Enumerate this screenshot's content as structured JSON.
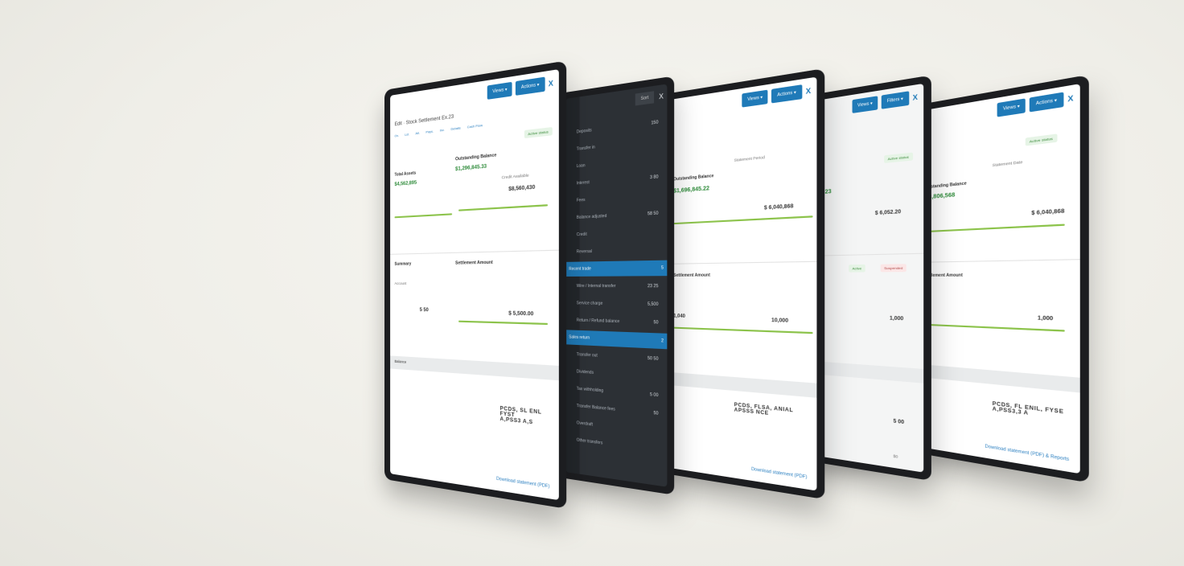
{
  "panels": {
    "p1": {
      "btn1": "Views ▾",
      "btn2": "Actions ▾",
      "close": "X",
      "header": "Edit · Stock Settlement Ex.23",
      "tabs": [
        "Ov.",
        "Lst.",
        "Alt.",
        "Pays.",
        "Inv.",
        "Details",
        "Cash Flow"
      ],
      "badge": "Active status",
      "outstanding_label": "Outstanding Balance",
      "outstanding_value": "$1,296,845.33",
      "left_label": "Total Assets",
      "left_value": "$4,562,895",
      "right_label": "Credit Available",
      "right_value": "$8,560,430",
      "section": "Summary",
      "settlement": "Settlement Amount",
      "account_name": "Account",
      "values_mid": [
        "5 50",
        "$ 5,500.00"
      ],
      "row_label": "Balance",
      "big_value": "PCDS, SL ENL FYST\nA,PSS3 A,S",
      "footer": "Download statement (PDF)"
    },
    "p2": {
      "top_box": "Sort",
      "close": "X",
      "rows": [
        {
          "label": "Deposits",
          "n": "150"
        },
        {
          "label": "Transfer in",
          "n": ""
        },
        {
          "label": "Loan",
          "n": ""
        },
        {
          "label": "Interest",
          "n": "3 80"
        },
        {
          "label": "Fees",
          "n": ""
        },
        {
          "label": "Balance adjusted",
          "n": "58 50"
        },
        {
          "label": "Credit",
          "n": ""
        },
        {
          "label": "Reversal",
          "n": ""
        },
        {
          "label": "Recent trade",
          "n": "5",
          "sel": true
        },
        {
          "label": "Wire / Internal transfer",
          "n": "23 25"
        },
        {
          "label": "Service charge",
          "n": "5,500"
        },
        {
          "label": "Return / Refund balance",
          "n": "50"
        },
        {
          "label": "Sales return",
          "n": "2",
          "sel": true
        },
        {
          "label": "Transfer out",
          "n": "50 50"
        },
        {
          "label": "Dividends",
          "n": ""
        },
        {
          "label": "Tax withholding",
          "n": "5 00"
        },
        {
          "label": "Transfer Balance fees",
          "n": "50"
        },
        {
          "label": "Overdraft",
          "n": ""
        },
        {
          "label": "Other transfers",
          "n": ""
        }
      ]
    },
    "p3": {
      "btn1": "Views ▾",
      "btn2": "Actions ▾",
      "close": "X",
      "outstanding_label": "Outstanding Balance",
      "outstanding_value": "$1,696,845.22",
      "right_label": "Statement Period",
      "right_value": "$ 6,040,868",
      "section": "Settlement Amount",
      "values": [
        "1,040",
        "10,000"
      ],
      "big_value": "PCDS, FLSA, ANIAL\nAPSSS NCE",
      "footer": "Download statement (PDF)"
    },
    "p4": {
      "btn1": "Views ▾",
      "btn2": "Filters ▾",
      "close": "X",
      "badge": "Active status",
      "badge2": "Active",
      "badge3": "Suspended",
      "left_value": "$ 2,323",
      "value2": "$ 6,052.20",
      "value3": "1,000",
      "footer_value": "5 00",
      "footer2": "$0"
    },
    "p5": {
      "btn1": "Views ▾",
      "btn2": "Actions ▾",
      "close": "X",
      "badge": "Active status",
      "outstanding_label": "Outstanding Balance",
      "outstanding_value": "$ 3,806,568",
      "right_label": "Statement Date",
      "right_value": "$ 6,040,868",
      "section": "Settlement Amount",
      "value2": "1,000",
      "big_value": "PCDS, FL ENIL, FYSE\nA,PSS3,3 A",
      "footer": "Download statement (PDF) & Reports"
    }
  }
}
